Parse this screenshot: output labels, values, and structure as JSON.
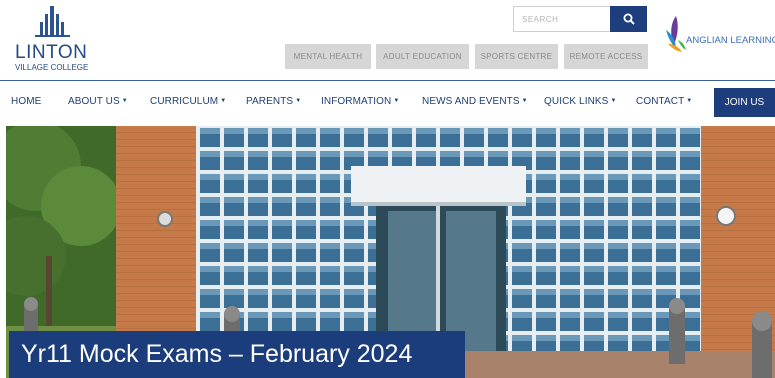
{
  "logo": {
    "name": "LINTON",
    "subtitle": "VILLAGE COLLEGE"
  },
  "search": {
    "placeholder": "SEARCH"
  },
  "quick_links": [
    {
      "label": "MENTAL HEALTH"
    },
    {
      "label": "ADULT EDUCATION"
    },
    {
      "label": "SPORTS CENTRE"
    },
    {
      "label": "REMOTE ACCESS"
    }
  ],
  "partner": {
    "name": "ANGLIAN LEARNING"
  },
  "nav": {
    "items": [
      {
        "label": "HOME"
      },
      {
        "label": "ABOUT US"
      },
      {
        "label": "CURRICULUM"
      },
      {
        "label": "PARENTS"
      },
      {
        "label": "INFORMATION"
      },
      {
        "label": "NEWS AND EVENTS"
      },
      {
        "label": "QUICK LINKS"
      },
      {
        "label": "CONTACT"
      }
    ],
    "caret": "▼",
    "join_label": "JOIN US"
  },
  "hero": {
    "caption": "Yr11 Mock Exams – February 2024"
  },
  "colors": {
    "brand_navy": "#1d3d7c",
    "quick_link_bg": "#d6d6d6",
    "brick": "#c27645"
  }
}
